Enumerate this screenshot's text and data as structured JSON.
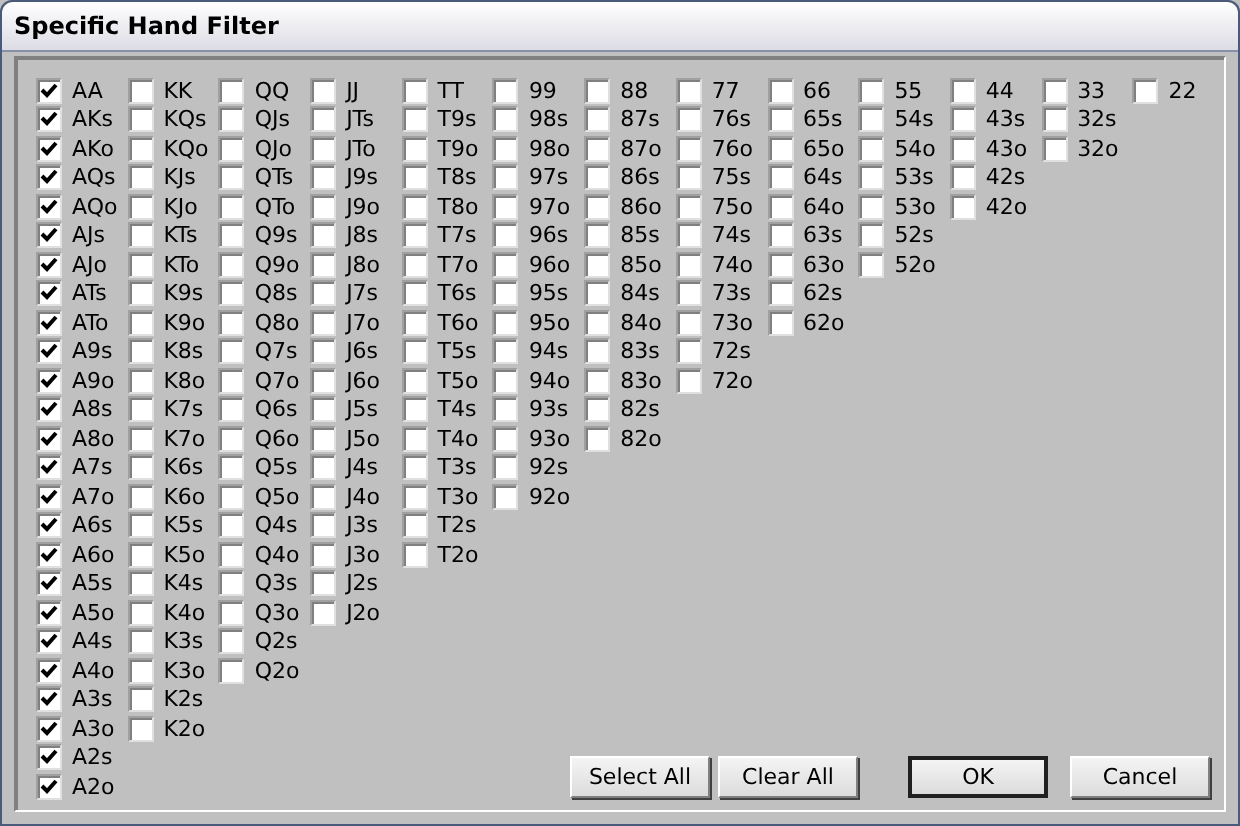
{
  "window": {
    "title": "Specific Hand Filter"
  },
  "columns": [
    {
      "hands": [
        {
          "label": "AA",
          "checked": true
        },
        {
          "label": "AKs",
          "checked": true
        },
        {
          "label": "AKo",
          "checked": true
        },
        {
          "label": "AQs",
          "checked": true
        },
        {
          "label": "AQo",
          "checked": true
        },
        {
          "label": "AJs",
          "checked": true
        },
        {
          "label": "AJo",
          "checked": true
        },
        {
          "label": "ATs",
          "checked": true
        },
        {
          "label": "ATo",
          "checked": true
        },
        {
          "label": "A9s",
          "checked": true
        },
        {
          "label": "A9o",
          "checked": true
        },
        {
          "label": "A8s",
          "checked": true
        },
        {
          "label": "A8o",
          "checked": true
        },
        {
          "label": "A7s",
          "checked": true
        },
        {
          "label": "A7o",
          "checked": true
        },
        {
          "label": "A6s",
          "checked": true
        },
        {
          "label": "A6o",
          "checked": true
        },
        {
          "label": "A5s",
          "checked": true
        },
        {
          "label": "A5o",
          "checked": true
        },
        {
          "label": "A4s",
          "checked": true
        },
        {
          "label": "A4o",
          "checked": true
        },
        {
          "label": "A3s",
          "checked": true
        },
        {
          "label": "A3o",
          "checked": true
        },
        {
          "label": "A2s",
          "checked": true
        },
        {
          "label": "A2o",
          "checked": true
        }
      ]
    },
    {
      "hands": [
        {
          "label": "KK",
          "checked": false
        },
        {
          "label": "KQs",
          "checked": false
        },
        {
          "label": "KQo",
          "checked": false
        },
        {
          "label": "KJs",
          "checked": false
        },
        {
          "label": "KJo",
          "checked": false
        },
        {
          "label": "KTs",
          "checked": false
        },
        {
          "label": "KTo",
          "checked": false
        },
        {
          "label": "K9s",
          "checked": false
        },
        {
          "label": "K9o",
          "checked": false
        },
        {
          "label": "K8s",
          "checked": false
        },
        {
          "label": "K8o",
          "checked": false
        },
        {
          "label": "K7s",
          "checked": false
        },
        {
          "label": "K7o",
          "checked": false
        },
        {
          "label": "K6s",
          "checked": false
        },
        {
          "label": "K6o",
          "checked": false
        },
        {
          "label": "K5s",
          "checked": false
        },
        {
          "label": "K5o",
          "checked": false
        },
        {
          "label": "K4s",
          "checked": false
        },
        {
          "label": "K4o",
          "checked": false
        },
        {
          "label": "K3s",
          "checked": false
        },
        {
          "label": "K3o",
          "checked": false
        },
        {
          "label": "K2s",
          "checked": false
        },
        {
          "label": "K2o",
          "checked": false
        }
      ]
    },
    {
      "hands": [
        {
          "label": "QQ",
          "checked": false
        },
        {
          "label": "QJs",
          "checked": false
        },
        {
          "label": "QJo",
          "checked": false
        },
        {
          "label": "QTs",
          "checked": false
        },
        {
          "label": "QTo",
          "checked": false
        },
        {
          "label": "Q9s",
          "checked": false
        },
        {
          "label": "Q9o",
          "checked": false
        },
        {
          "label": "Q8s",
          "checked": false
        },
        {
          "label": "Q8o",
          "checked": false
        },
        {
          "label": "Q7s",
          "checked": false
        },
        {
          "label": "Q7o",
          "checked": false
        },
        {
          "label": "Q6s",
          "checked": false
        },
        {
          "label": "Q6o",
          "checked": false
        },
        {
          "label": "Q5s",
          "checked": false
        },
        {
          "label": "Q5o",
          "checked": false
        },
        {
          "label": "Q4s",
          "checked": false
        },
        {
          "label": "Q4o",
          "checked": false
        },
        {
          "label": "Q3s",
          "checked": false
        },
        {
          "label": "Q3o",
          "checked": false
        },
        {
          "label": "Q2s",
          "checked": false
        },
        {
          "label": "Q2o",
          "checked": false
        }
      ]
    },
    {
      "hands": [
        {
          "label": "JJ",
          "checked": false
        },
        {
          "label": "JTs",
          "checked": false
        },
        {
          "label": "JTo",
          "checked": false
        },
        {
          "label": "J9s",
          "checked": false
        },
        {
          "label": "J9o",
          "checked": false
        },
        {
          "label": "J8s",
          "checked": false
        },
        {
          "label": "J8o",
          "checked": false
        },
        {
          "label": "J7s",
          "checked": false
        },
        {
          "label": "J7o",
          "checked": false
        },
        {
          "label": "J6s",
          "checked": false
        },
        {
          "label": "J6o",
          "checked": false
        },
        {
          "label": "J5s",
          "checked": false
        },
        {
          "label": "J5o",
          "checked": false
        },
        {
          "label": "J4s",
          "checked": false
        },
        {
          "label": "J4o",
          "checked": false
        },
        {
          "label": "J3s",
          "checked": false
        },
        {
          "label": "J3o",
          "checked": false
        },
        {
          "label": "J2s",
          "checked": false
        },
        {
          "label": "J2o",
          "checked": false
        }
      ]
    },
    {
      "hands": [
        {
          "label": "TT",
          "checked": false
        },
        {
          "label": "T9s",
          "checked": false
        },
        {
          "label": "T9o",
          "checked": false
        },
        {
          "label": "T8s",
          "checked": false
        },
        {
          "label": "T8o",
          "checked": false
        },
        {
          "label": "T7s",
          "checked": false
        },
        {
          "label": "T7o",
          "checked": false
        },
        {
          "label": "T6s",
          "checked": false
        },
        {
          "label": "T6o",
          "checked": false
        },
        {
          "label": "T5s",
          "checked": false
        },
        {
          "label": "T5o",
          "checked": false
        },
        {
          "label": "T4s",
          "checked": false
        },
        {
          "label": "T4o",
          "checked": false
        },
        {
          "label": "T3s",
          "checked": false
        },
        {
          "label": "T3o",
          "checked": false
        },
        {
          "label": "T2s",
          "checked": false
        },
        {
          "label": "T2o",
          "checked": false
        }
      ]
    },
    {
      "hands": [
        {
          "label": "99",
          "checked": false
        },
        {
          "label": "98s",
          "checked": false
        },
        {
          "label": "98o",
          "checked": false
        },
        {
          "label": "97s",
          "checked": false
        },
        {
          "label": "97o",
          "checked": false
        },
        {
          "label": "96s",
          "checked": false
        },
        {
          "label": "96o",
          "checked": false
        },
        {
          "label": "95s",
          "checked": false
        },
        {
          "label": "95o",
          "checked": false
        },
        {
          "label": "94s",
          "checked": false
        },
        {
          "label": "94o",
          "checked": false
        },
        {
          "label": "93s",
          "checked": false
        },
        {
          "label": "93o",
          "checked": false
        },
        {
          "label": "92s",
          "checked": false
        },
        {
          "label": "92o",
          "checked": false
        }
      ]
    },
    {
      "hands": [
        {
          "label": "88",
          "checked": false
        },
        {
          "label": "87s",
          "checked": false
        },
        {
          "label": "87o",
          "checked": false
        },
        {
          "label": "86s",
          "checked": false
        },
        {
          "label": "86o",
          "checked": false
        },
        {
          "label": "85s",
          "checked": false
        },
        {
          "label": "85o",
          "checked": false
        },
        {
          "label": "84s",
          "checked": false
        },
        {
          "label": "84o",
          "checked": false
        },
        {
          "label": "83s",
          "checked": false
        },
        {
          "label": "83o",
          "checked": false
        },
        {
          "label": "82s",
          "checked": false
        },
        {
          "label": "82o",
          "checked": false
        }
      ]
    },
    {
      "hands": [
        {
          "label": "77",
          "checked": false
        },
        {
          "label": "76s",
          "checked": false
        },
        {
          "label": "76o",
          "checked": false
        },
        {
          "label": "75s",
          "checked": false
        },
        {
          "label": "75o",
          "checked": false
        },
        {
          "label": "74s",
          "checked": false
        },
        {
          "label": "74o",
          "checked": false
        },
        {
          "label": "73s",
          "checked": false
        },
        {
          "label": "73o",
          "checked": false
        },
        {
          "label": "72s",
          "checked": false
        },
        {
          "label": "72o",
          "checked": false
        }
      ]
    },
    {
      "hands": [
        {
          "label": "66",
          "checked": false
        },
        {
          "label": "65s",
          "checked": false
        },
        {
          "label": "65o",
          "checked": false
        },
        {
          "label": "64s",
          "checked": false
        },
        {
          "label": "64o",
          "checked": false
        },
        {
          "label": "63s",
          "checked": false
        },
        {
          "label": "63o",
          "checked": false
        },
        {
          "label": "62s",
          "checked": false
        },
        {
          "label": "62o",
          "checked": false
        }
      ]
    },
    {
      "hands": [
        {
          "label": "55",
          "checked": false
        },
        {
          "label": "54s",
          "checked": false
        },
        {
          "label": "54o",
          "checked": false
        },
        {
          "label": "53s",
          "checked": false
        },
        {
          "label": "53o",
          "checked": false
        },
        {
          "label": "52s",
          "checked": false
        },
        {
          "label": "52o",
          "checked": false
        }
      ]
    },
    {
      "hands": [
        {
          "label": "44",
          "checked": false
        },
        {
          "label": "43s",
          "checked": false
        },
        {
          "label": "43o",
          "checked": false
        },
        {
          "label": "42s",
          "checked": false
        },
        {
          "label": "42o",
          "checked": false
        }
      ]
    },
    {
      "hands": [
        {
          "label": "33",
          "checked": false
        },
        {
          "label": "32s",
          "checked": false
        },
        {
          "label": "32o",
          "checked": false
        }
      ]
    },
    {
      "hands": [
        {
          "label": "22",
          "checked": false
        }
      ]
    }
  ],
  "buttons": [
    {
      "label": "Select All",
      "default": false
    },
    {
      "label": "Clear All",
      "default": false
    },
    {
      "label": "OK",
      "default": true
    },
    {
      "label": "Cancel",
      "default": false
    }
  ]
}
